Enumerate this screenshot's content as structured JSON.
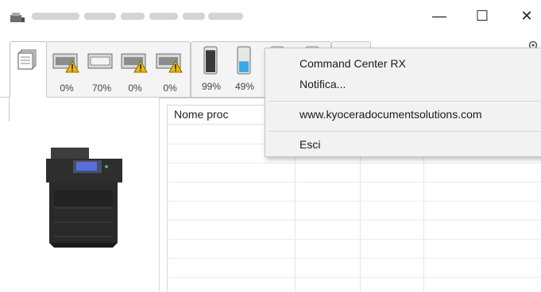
{
  "window": {
    "title_hidden": true,
    "minimize_symbol": "—",
    "maximize_symbol": "☐",
    "close_symbol": "✕"
  },
  "tabs": {
    "trays": [
      {
        "id": "tray-1",
        "level": "0%",
        "warning": true
      },
      {
        "id": "tray-2",
        "level": "70%",
        "warning": false
      },
      {
        "id": "tray-3",
        "level": "0%",
        "warning": true
      },
      {
        "id": "tray-4",
        "level": "0%",
        "warning": true
      }
    ],
    "toners": [
      {
        "id": "toner-k",
        "level": "99%",
        "fill": 0.99
      },
      {
        "id": "toner-c",
        "level": "49%",
        "fill": 0.49
      }
    ]
  },
  "job_list": {
    "column_header": "Nome proc"
  },
  "context_menu": {
    "items": [
      "Command Center RX",
      "Notifica...",
      "www.kyoceradocumentsolutions.com",
      "Esci"
    ]
  },
  "colors": {
    "warning": "#f2b705",
    "toner_cyan": "#39a9e8",
    "toner_black": "#3a3a3a"
  }
}
